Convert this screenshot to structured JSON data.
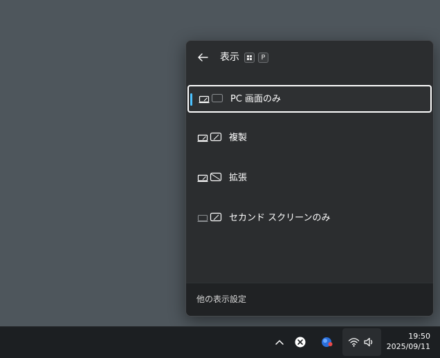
{
  "panel": {
    "title": "表示",
    "shortcut": {
      "win_icon": "windows-logo-icon",
      "key": "P"
    },
    "options": [
      {
        "label": "PC 画面のみ",
        "icon": "pc-screen-only-icon",
        "selected": true
      },
      {
        "label": "複製",
        "icon": "duplicate-icon",
        "selected": false
      },
      {
        "label": "拡張",
        "icon": "extend-icon",
        "selected": false
      },
      {
        "label": "セカンド スクリーンのみ",
        "icon": "second-screen-only-icon",
        "selected": false
      }
    ],
    "footer_link": "他の表示設定"
  },
  "taskbar": {
    "tray_icons": [
      "chevron-up-icon",
      "x-app-icon",
      "color-app-icon",
      "wifi-icon",
      "volume-icon"
    ],
    "time": "19:50",
    "date": "2025/09/11"
  },
  "colors": {
    "accent": "#4cc2ff",
    "panel_bg": "#2b2d2f",
    "desktop_bg": "#4e565c",
    "taskbar_bg": "#1c1f22"
  }
}
